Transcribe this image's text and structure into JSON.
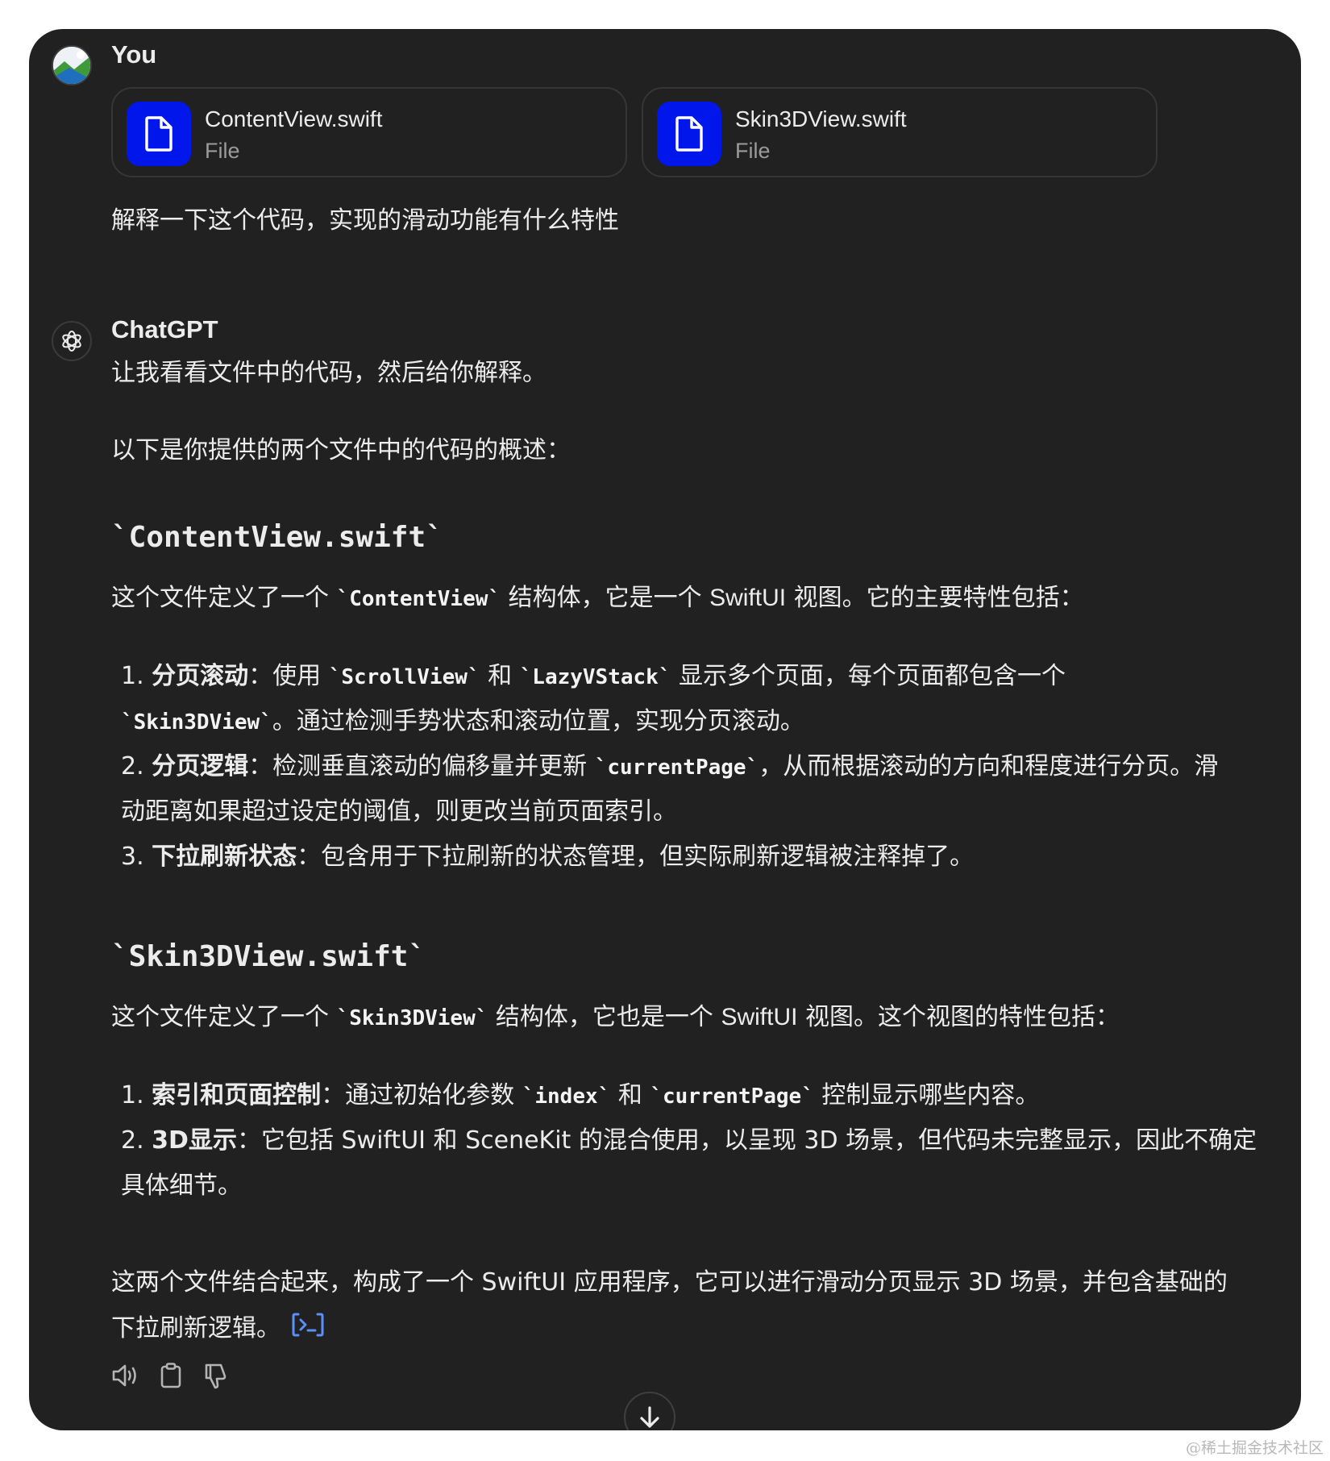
{
  "user": {
    "name": "You",
    "avatar_icon": "landscape-avatar-icon",
    "files": [
      {
        "name": "ContentView.swift",
        "type": "File",
        "icon": "document-icon"
      },
      {
        "name": "Skin3DView.swift",
        "type": "File",
        "icon": "document-icon"
      }
    ],
    "message": "解释一下这个代码，实现的滑动功能有什么特性"
  },
  "assistant": {
    "name": "ChatGPT",
    "avatar_icon": "openai-logo-icon",
    "intro": "让我看看文件中的代码，然后给你解释。",
    "overview": "以下是你提供的两个文件中的代码的概述：",
    "section1": {
      "heading": "`ContentView.swift`",
      "desc_pre": "这个文件定义了一个 ",
      "desc_code": "`ContentView`",
      "desc_mid": " 结构体，它是一个 ",
      "desc_latin": "SwiftUI",
      "desc_post": " 视图。它的主要特性包括：",
      "items": [
        {
          "num": "1. ",
          "title": "分页滚动",
          "p1": "：使用 ",
          "c1": "`ScrollView`",
          "p2": " 和 ",
          "c2": "`LazyVStack`",
          "p3": " 显示多个页面，每个页面都包含一个",
          "c3": "`Skin3DView`",
          "p4": "。通过检测手势状态和滚动位置，实现分页滚动。"
        },
        {
          "num": "2. ",
          "title": "分页逻辑",
          "p1": "：检测垂直滚动的偏移量并更新 ",
          "c1": "`currentPage`",
          "p2": "，从而根据滚动的方向和程度进行分页。滑",
          "p3": "动距离如果超过设定的阈值，则更改当前页面索引。"
        },
        {
          "num": "3. ",
          "title": "下拉刷新状态",
          "p1": "：包含用于下拉刷新的状态管理，但实际刷新逻辑被注释掉了。"
        }
      ]
    },
    "section2": {
      "heading": "`Skin3DView.swift`",
      "desc_pre": "这个文件定义了一个 ",
      "desc_code": "`Skin3DView`",
      "desc_mid": " 结构体，它也是一个 ",
      "desc_latin": "SwiftUI",
      "desc_post": " 视图。这个视图的特性包括：",
      "items": [
        {
          "num": "1. ",
          "title": "索引和页面控制",
          "p1": "：通过初始化参数 ",
          "c1": "`index`",
          "p2": " 和 ",
          "c2": "`currentPage`",
          "p3": " 控制显示哪些内容。"
        },
        {
          "num": "2. ",
          "title": "3D显示",
          "p1": "：它包括 SwiftUI 和 SceneKit 的混合使用，以呈现 3D 场景，但代码未完整显示，因此不确定",
          "p2": "具体细节。"
        }
      ]
    },
    "summary_line1": "这两个文件结合起来，构成了一个 SwiftUI 应用程序，它可以进行滑动分页显示 3D 场景，并包含基础的",
    "summary_line2": "下拉刷新逻辑。",
    "summary_icon": "code-interpreter-icon",
    "actions": [
      "read-aloud-icon",
      "copy-icon",
      "thumbs-down-icon"
    ],
    "scroll_icon": "arrow-down-icon"
  },
  "watermark": "@稀土掘金技术社区",
  "colors": {
    "panel": "#212121",
    "file_icon_bg": "#0016ea",
    "link": "#5b8ff9"
  }
}
